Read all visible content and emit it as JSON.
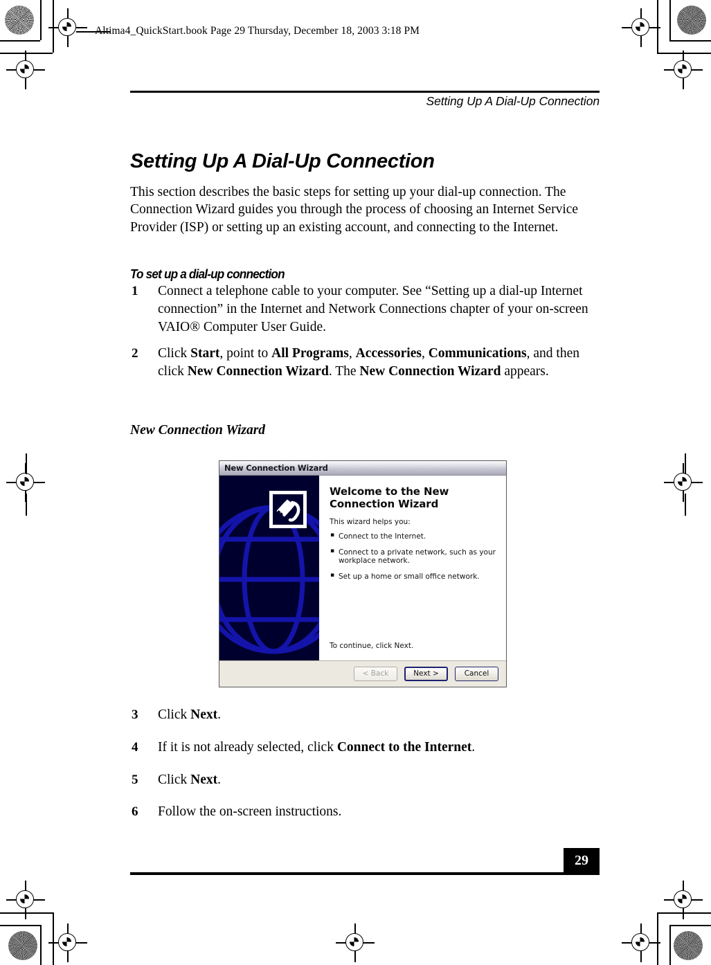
{
  "slug": {
    "text": "Altima4_QuickStart.book  Page 29  Thursday, December 18, 2003  3:18 PM"
  },
  "header": {
    "running_head": "Setting Up A Dial-Up Connection"
  },
  "content": {
    "heading": "Setting Up A Dial-Up Connection",
    "intro": "This section describes the basic steps for setting up your dial-up connection. The Connection Wizard guides you through the process of choosing an Internet Service Provider (ISP) or setting up an existing account, and connecting to the Internet.",
    "subheading": "To set up a dial-up connection",
    "steps_top": [
      {
        "number": "1",
        "html": "Connect a telephone cable to your computer. See “Setting up a dial-up Internet connection” in the Internet and Network Connections chapter of your on-screen VAIO® Computer User Guide."
      },
      {
        "number": "2",
        "html": "Click <b>Start</b>, point to <b>All Programs</b>, <b>Accessories</b>, <b>Communications</b>, and then click <b>New Connection Wizard</b>. The <b>New Connection Wizard</b> appears."
      }
    ],
    "figure_caption": "New Connection Wizard",
    "steps_bottom": [
      {
        "number": "3",
        "html": "Click <b>Next</b>."
      },
      {
        "number": "4",
        "html": "If it is not already selected, click <b>Connect to the Internet</b>."
      },
      {
        "number": "5",
        "html": "Click <b>Next</b>."
      },
      {
        "number": "6",
        "html": "Follow the on-screen instructions."
      }
    ]
  },
  "dialog": {
    "title": "New Connection Wizard",
    "welcome_title": "Welcome to the New Connection Wizard",
    "helps_intro": "This wizard helps you:",
    "bullets": [
      "Connect to the Internet.",
      "Connect to a private network, such as your workplace network.",
      "Set up a home or small office network."
    ],
    "continue_text": "To continue, click Next.",
    "buttons": {
      "back": "< Back",
      "next": "Next >",
      "cancel": "Cancel"
    },
    "colors": {
      "banner_background": "#00002e",
      "globe_line": "#1111a8",
      "titlebar_text": "#16161e",
      "footer_background": "#ece9e1",
      "button_border": "#25286b"
    }
  },
  "footer": {
    "page_number": "29"
  }
}
